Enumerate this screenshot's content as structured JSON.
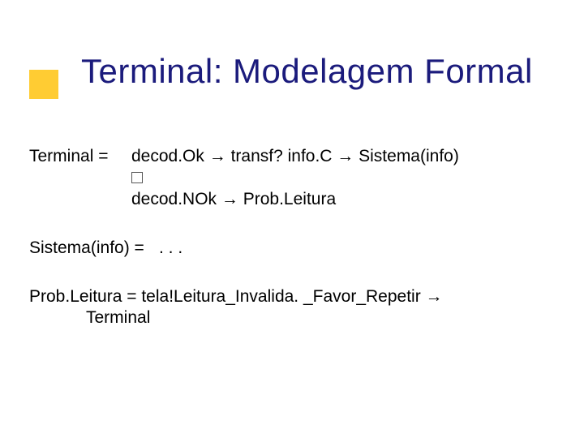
{
  "title": "Terminal: Modelagem Formal",
  "defs": {
    "terminal": {
      "lhs": "Terminal =",
      "line1_a": "decod.Ok ",
      "line1_b": " transf? info.C ",
      "line1_c": " Sistema(info)",
      "arrow": "→",
      "line2_a": "decod.NOk ",
      "line2_b": " Prob.Leitura"
    },
    "sistema": {
      "lhs": "Sistema(info) =",
      "rhs": ". . ."
    },
    "probleitura": {
      "line1_a": "Prob.Leitura = tela!Leitura_Invalida. _Favor_Repetir ",
      "arrow": "→",
      "cont": "Terminal"
    }
  }
}
